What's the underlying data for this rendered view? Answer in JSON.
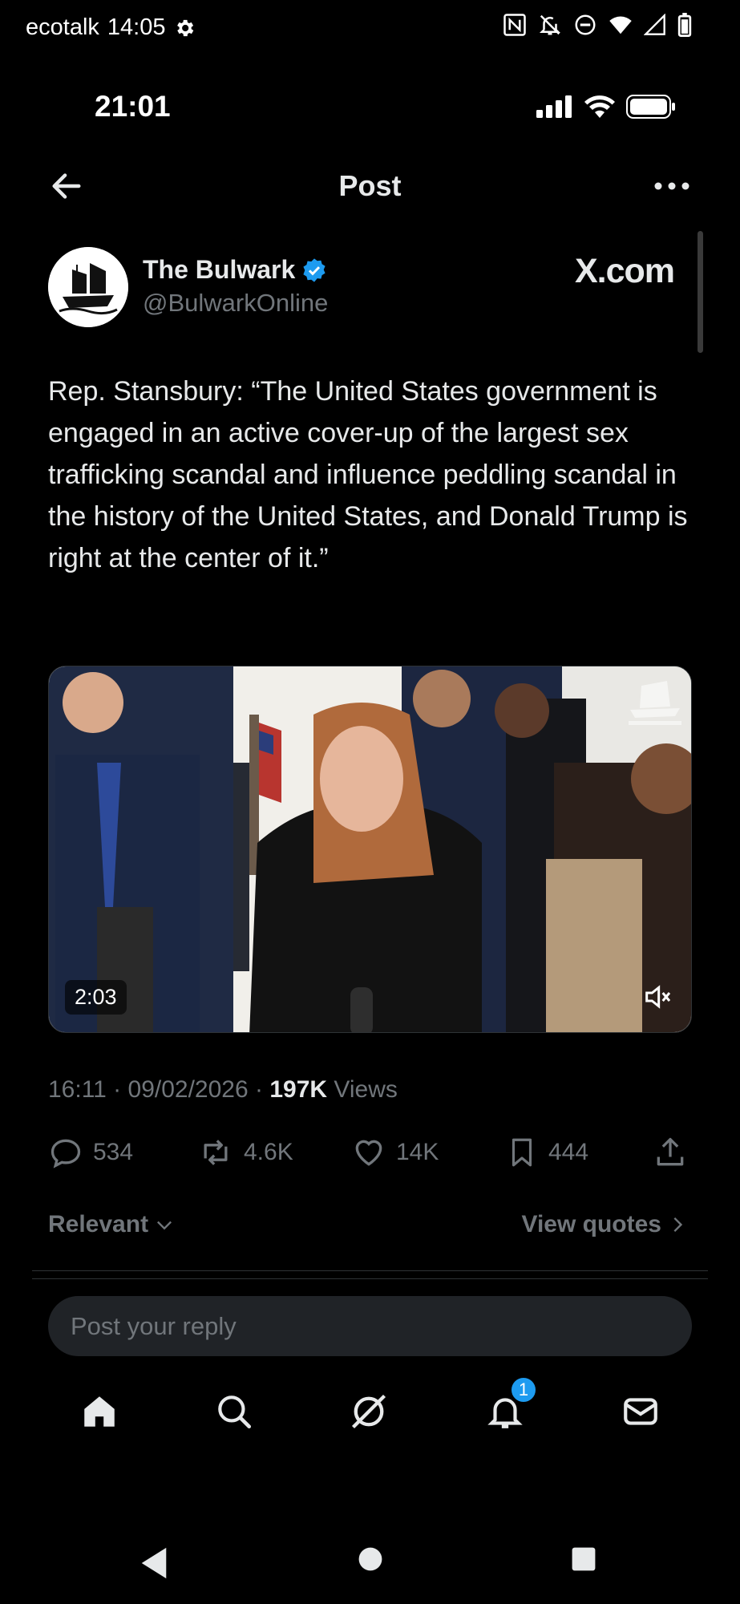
{
  "outer_status": {
    "carrier": "ecotalk",
    "time": "14:05"
  },
  "ios_status": {
    "time": "21:01"
  },
  "header": {
    "title": "Post"
  },
  "author": {
    "name": "The Bulwark",
    "handle": "@BulwarkOnline",
    "verified": true,
    "site_label": "X.com"
  },
  "post": {
    "text": "Rep. Stansbury: “The United States government is engaged in an active cover-up of the largest sex trafficking scandal and influence peddling scandal in the history of the United States, and Donald Trump is right at the center of it.”",
    "video_duration": "2:03",
    "timestamp": "16:11 · 09/02/2026 · ",
    "views_count": "197K",
    "views_label": " Views"
  },
  "actions": {
    "replies": "534",
    "reposts": "4.6K",
    "likes": "14K",
    "bookmarks": "444"
  },
  "sort": {
    "relevant_label": "Relevant",
    "view_quotes_label": "View quotes"
  },
  "reply": {
    "placeholder": "Post your reply"
  },
  "tabbar": {
    "notifications_badge": "1"
  },
  "colors": {
    "accent": "#1d9bf0",
    "muted": "#71767b",
    "text": "#e7e9ea",
    "background": "#000000"
  }
}
